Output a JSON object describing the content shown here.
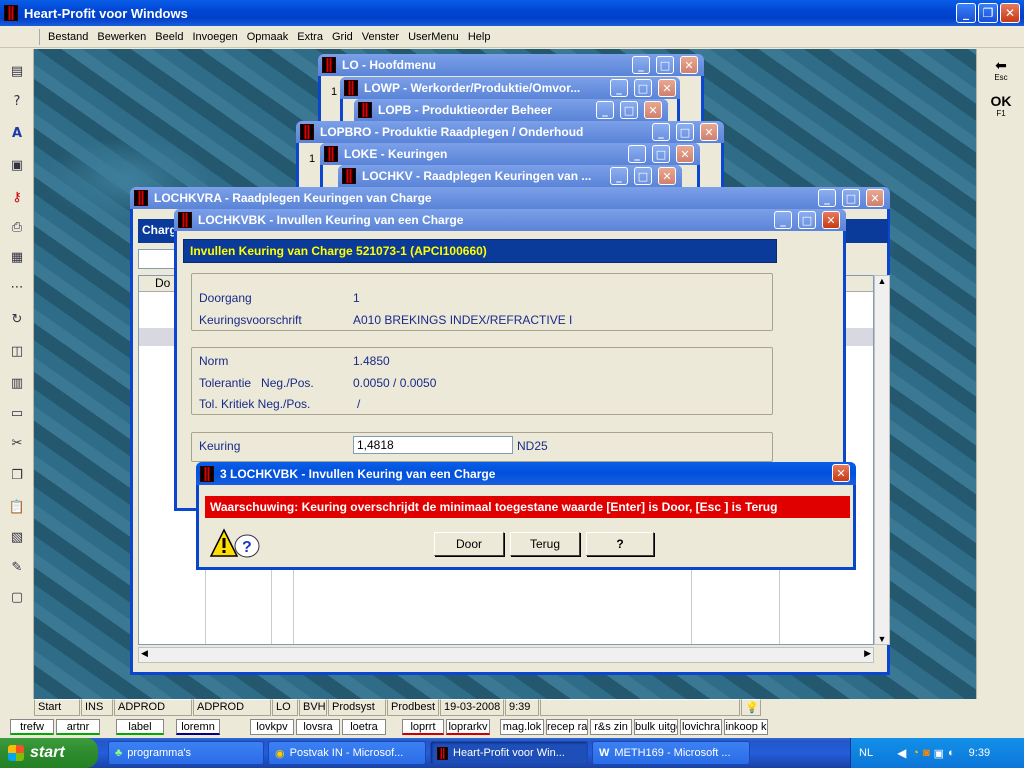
{
  "app": {
    "title": "Heart-Profit voor Windows"
  },
  "menu": [
    "Bestand",
    "Bewerken",
    "Beeld",
    "Invoegen",
    "Opmaak",
    "Extra",
    "Grid",
    "Venster",
    "UserMenu",
    "Help"
  ],
  "bg_windows": [
    {
      "title": "LO - Hoofdmenu",
      "num": "1"
    },
    {
      "title": "LOWP - Werkorder/Produktie/Omvor..."
    },
    {
      "title": "LOPB - Produktieorder Beheer"
    },
    {
      "title": "LOPBRO - Produktie Raadplegen / Onderhoud",
      "num": "1"
    },
    {
      "title": "LOKE - Keuringen"
    },
    {
      "title": "LOCHKV - Raadplegen Keuringen van ..."
    }
  ],
  "raadpleeg": {
    "title": "LOCHKVRA - Raadplegen Keuringen van Charge",
    "tab": "Charg",
    "col": "Do"
  },
  "form": {
    "title": "LOCHKVBK - Invullen Keuring van een Charge",
    "header": "Invullen Keuring van Charge 521073-1    (APCI100660)",
    "doorgang_label": "Doorgang",
    "doorgang_value": "1",
    "voorschrift_label": "Keuringsvoorschrift",
    "voorschrift_value": "A010 BREKINGS INDEX/REFRACTIVE I",
    "norm_label": "Norm",
    "norm_value": "1.4850",
    "tol_label": "Tolerantie   Neg./Pos.",
    "tol_value": "0.0050 / 0.0050",
    "tolk_label": "Tol. Kritiek Neg./Pos.",
    "tolk_value": "/",
    "keuring_label": "Keuring",
    "keuring_value": "1,4818",
    "keuring_unit": "ND25"
  },
  "dialog": {
    "title": "3 LOCHKVBK - Invullen Keuring van een Charge",
    "message": "Waarschuwing: Keuring overschrijdt de minimaal toegestane waarde [Enter] is Door, [Esc  ] is Terug",
    "btn_door": "Door",
    "btn_terug": "Terug",
    "btn_help": "?"
  },
  "right_toolbar": {
    "esc": "Esc",
    "ok": "OK",
    "f1": "F1"
  },
  "status": [
    "Start",
    "INS",
    "ADPROD",
    "ADPROD",
    "LO",
    "BVH",
    "Prodsyst",
    "Prodbest",
    "19-03-2008",
    "9:39"
  ],
  "shortcuts": [
    "trefw",
    "artnr",
    "label",
    "loremn",
    "lovkpv",
    "lovsra",
    "loetra",
    "loprrt",
    "loprarkv",
    "mag.lok",
    "recep ra",
    "r&s zin",
    "bulk uitge",
    "lovichra",
    "inkoop k"
  ],
  "taskbar": {
    "start": "start",
    "tasks": [
      "programma's",
      "Postvak IN - Microsof...",
      "Heart-Profit voor Win...",
      "METH169 - Microsoft ..."
    ],
    "lang": "NL",
    "clock": "9:39"
  },
  "colors": {
    "title_blue": "#0050dc",
    "warn_red": "#e00000",
    "header_blue": "#0a3a9a",
    "header_text": "#ffff00"
  }
}
